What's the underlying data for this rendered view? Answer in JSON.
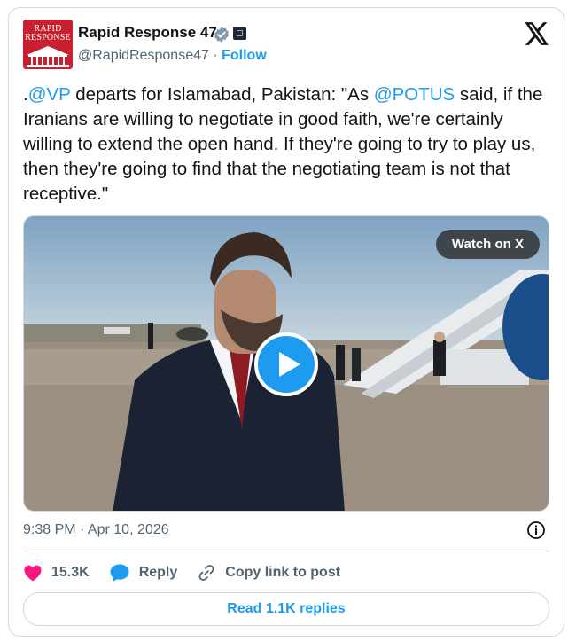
{
  "author": {
    "avatar_text_line1": "RAPID",
    "avatar_text_line2": "RESPONSE",
    "name": "Rapid Response 47",
    "handle": "@RapidResponse47",
    "separator": " · ",
    "follow_label": "Follow",
    "verified_icon": "verified-badge-icon",
    "affiliation_icon": "affiliation-badge-icon"
  },
  "tweet": {
    "text_parts": {
      "p1": ".",
      "mention_vp": "@VP",
      "p2": " departs for Islamabad, Pakistan: \"As ",
      "mention_potus": "@POTUS",
      "p3": " said, if the Iranians are willing to negotiate in good faith, we're certainly willing to extend the open hand. If they're going to try to play us, then they're going to find that the negotiating team is not that receptive.\""
    },
    "media": {
      "watch_label": "Watch on X",
      "play_icon": "play-icon"
    },
    "timestamp": "9:38 PM · Apr 10, 2026"
  },
  "actions": {
    "likes_count": "15.3K",
    "reply_label": "Reply",
    "copy_link_label": "Copy link to post"
  },
  "footer": {
    "read_replies_label": "Read 1.1K replies"
  },
  "colors": {
    "accent": "#1d9bf0",
    "like": "#f91880",
    "brand_red": "#c8202f",
    "text_secondary": "#536471"
  }
}
